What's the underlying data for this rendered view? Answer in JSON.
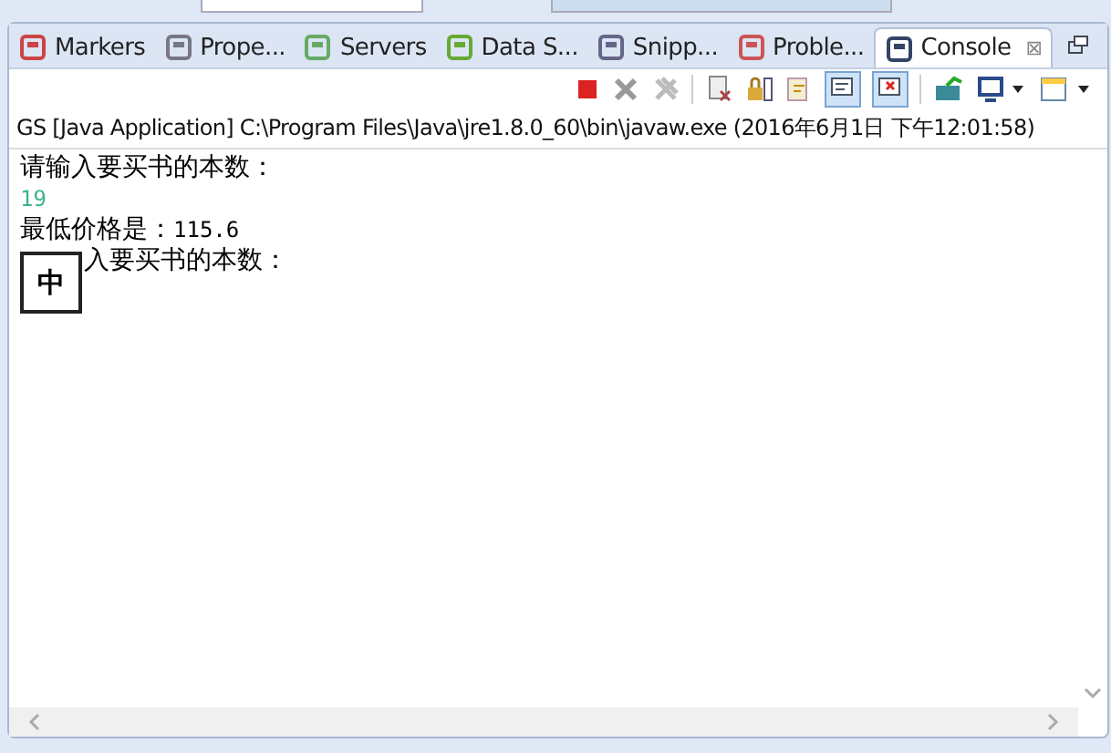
{
  "tabs": [
    {
      "label": "Markers",
      "selected": false
    },
    {
      "label": "Prope...",
      "selected": false
    },
    {
      "label": "Servers",
      "selected": false
    },
    {
      "label": "Data S...",
      "selected": false
    },
    {
      "label": "Snipp...",
      "selected": false
    },
    {
      "label": "Proble...",
      "selected": false
    },
    {
      "label": "Console",
      "selected": true
    }
  ],
  "close_glyph": "⊠",
  "console": {
    "title": "GS [Java Application] C:\\Program Files\\Java\\jre1.8.0_60\\bin\\javaw.exe (2016年6月1日 下午12:01:58)",
    "lines": [
      {
        "kind": "output",
        "parts": [
          "请输入要买书的本数："
        ]
      },
      {
        "kind": "input",
        "parts": [
          "19"
        ]
      },
      {
        "kind": "output",
        "parts": [
          "最低价格是：",
          "115.6"
        ]
      },
      {
        "kind": "output",
        "covered": true,
        "parts": [
          "入要买书的本数："
        ]
      }
    ]
  },
  "ime": {
    "label": "中"
  }
}
